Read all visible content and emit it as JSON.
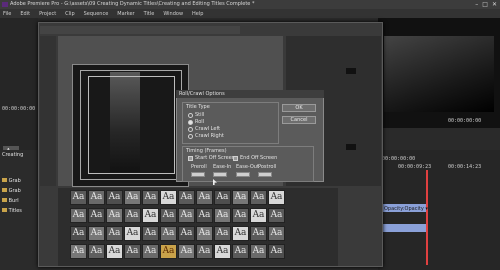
{
  "app": {
    "title": "Adobe Premiere Pro - G:\\assets\\09 Creating Dynamic Titles\\Creating and Editing Titles Complete *",
    "window_controls": [
      "–",
      "□",
      "✕"
    ]
  },
  "menu": [
    "File",
    "Edit",
    "Project",
    "Clip",
    "Sequence",
    "Marker",
    "Title",
    "Window",
    "Help"
  ],
  "left_panel": {
    "timecodes": [
      "00:00:00:00",
      "00:00:00:00"
    ],
    "creating_tab": "Creating",
    "project_items": [
      "Grab",
      "Grab",
      "Burl",
      "Titles"
    ]
  },
  "right_timecodes": [
    "00:00:00:00",
    "00:00:00:00",
    "00:00:00:00"
  ],
  "timeline": {
    "timecodes": [
      "00:00:00:00",
      "00:00:09:23",
      "00:00:14:23"
    ],
    "clip_label": "Opacity:Opacity ▾"
  },
  "style_tiles": [
    "Aa",
    "Aa",
    "Aa",
    "Aa",
    "Aa",
    "Aa",
    "Aa",
    "Aa",
    "Aa",
    "Aa",
    "Aa",
    "Aa",
    "Aa",
    "Aa",
    "Aa",
    "Aa",
    "Aa",
    "Aa",
    "Aa",
    "Aa",
    "Aa",
    "Aa",
    "Aa",
    "Aa",
    "Aa",
    "Aa",
    "Aa",
    "Aa",
    "Aa",
    "Aa",
    "Aa",
    "Aa",
    "Aa",
    "Aa",
    "Aa",
    "Aa",
    "Aa",
    "Aa",
    "Aa",
    "Aa",
    "Aa",
    "Aa",
    "Aa",
    "Aa",
    "Aa",
    "Aa",
    "Aa",
    "Aa"
  ],
  "dialog": {
    "title": "Roll/Crawl Options",
    "title_type_label": "Title Type",
    "options": [
      "Still",
      "Roll",
      "Crawl Left",
      "Crawl Right"
    ],
    "selected_option": "Roll",
    "timing_label": "Timing (Frames)",
    "start_off_screen": "Start Off Screen",
    "end_off_screen": "End Off Screen",
    "fields": [
      "Preroll",
      "Ease-In",
      "Ease-Out",
      "Postroll"
    ],
    "ok": "OK",
    "cancel": "Cancel"
  }
}
